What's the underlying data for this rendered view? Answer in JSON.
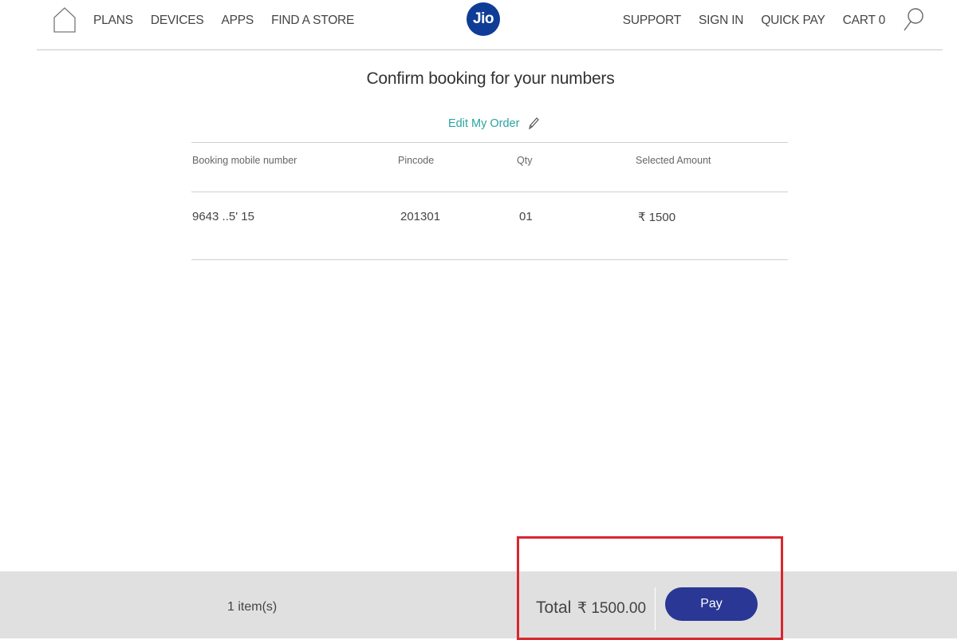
{
  "header": {
    "nav_left": [
      "PLANS",
      "DEVICES",
      "APPS",
      "FIND A STORE"
    ],
    "logo_text": "Jio",
    "nav_right": [
      "SUPPORT",
      "SIGN IN",
      "QUICK PAY",
      "CART 0"
    ]
  },
  "main": {
    "title": "Confirm booking for your numbers",
    "edit_order": "Edit My Order",
    "columns": [
      "Booking mobile number",
      "Pincode",
      "Qty",
      "Selected Amount"
    ],
    "row": {
      "mobile": "9643 ..5' 15",
      "pincode": "201301",
      "qty": "01",
      "amount": "₹ 1500"
    }
  },
  "footer": {
    "items": "1 item(s)",
    "total_label": "Total",
    "total_value": "₹ 1500.00",
    "pay_label": "Pay"
  },
  "colors": {
    "brand": "#0f3c96",
    "pay_button": "#2a3795",
    "link": "#2aa3a3",
    "highlight": "#d9262f"
  },
  "icons": [
    "home-icon",
    "search-icon",
    "pencil-icon"
  ]
}
